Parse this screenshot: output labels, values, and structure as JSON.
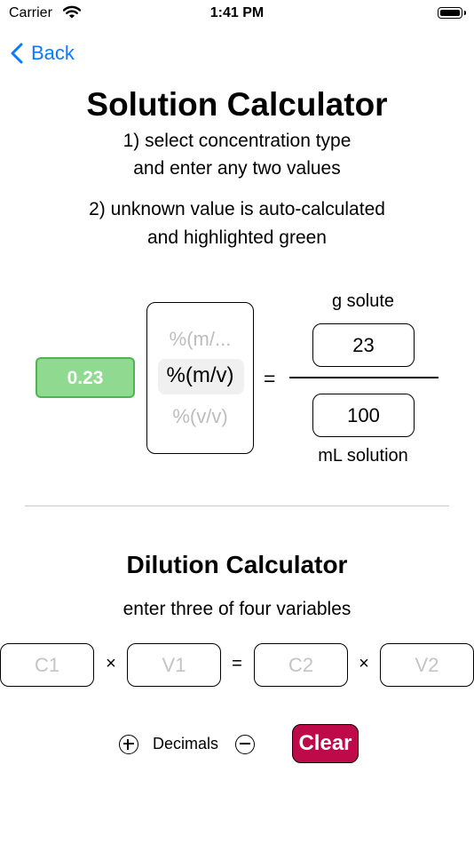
{
  "status_bar": {
    "carrier": "Carrier",
    "time": "1:41 PM"
  },
  "nav": {
    "back_label": "Back"
  },
  "solution": {
    "title": "Solution Calculator",
    "step1_line1": "1) select concentration type",
    "step1_line2": "and enter any two values",
    "step2_line1": "2) unknown value is auto-calculated",
    "step2_line2": "and highlighted green",
    "result": "0.23",
    "picker_options": [
      "%(m/...",
      "%(m/v)",
      "%(v/v)"
    ],
    "selected_option": "%(m/v)",
    "equals": "=",
    "numerator_label": "g solute",
    "numerator_value": "23",
    "denominator_value": "100",
    "denominator_label": "mL solution"
  },
  "dilution": {
    "title": "Dilution Calculator",
    "instruction": "enter three of four variables",
    "placeholders": {
      "c1": "C1",
      "v1": "V1",
      "c2": "C2",
      "v2": "V2"
    },
    "times": "×",
    "equals": "="
  },
  "controls": {
    "decimals_label": "Decimals",
    "clear_label": "Clear"
  },
  "colors": {
    "accent": "#0a7aff",
    "result_bg": "#8fd990",
    "result_border": "#4ab84e",
    "clear_bg": "#bf0a4a"
  },
  "icons": [
    "wifi-icon",
    "battery-icon",
    "chevron-left-icon",
    "plus-circle-icon",
    "minus-circle-icon"
  ]
}
